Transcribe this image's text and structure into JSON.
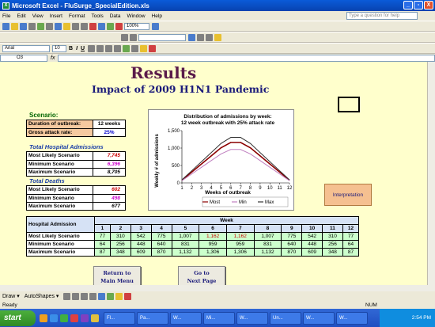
{
  "window": {
    "title": "Microsoft Excel - FluSurge_SpecialEdition.xls",
    "minimize": "_",
    "restore": "▫",
    "close": "X"
  },
  "menu": {
    "items": [
      "File",
      "Edit",
      "View",
      "Insert",
      "Format",
      "Tools",
      "Data",
      "Window",
      "Help"
    ],
    "help_placeholder": "Type a question for help"
  },
  "toolbar": {
    "zoom": "100%",
    "font_name": "Arial",
    "font_size": "10",
    "bold": "B",
    "italic": "I",
    "underline": "U"
  },
  "formula_bar": {
    "name_box": "O3",
    "fx": "fx",
    "content": ""
  },
  "sheet": {
    "title": "Results",
    "subtitle": "Impact of 2009 H1N1 Pandemic",
    "scenario_label": "Scenario:",
    "scenario": [
      {
        "key": "Duration of outbreak:",
        "value": "12 weeks"
      },
      {
        "key": "Gross attack rate:",
        "value": "25%"
      }
    ],
    "admissions_label": "Total Hospital Admissions",
    "admissions": [
      {
        "key": "Most Likely Scenario",
        "value": "7,745",
        "color": "#cc0000"
      },
      {
        "key": "Minimum Scenario",
        "value": "6,396",
        "color": "#cc00cc"
      },
      {
        "key": "Maximum Scenario",
        "value": "8,705",
        "color": "#000000"
      }
    ],
    "deaths_label": "Total Deaths",
    "deaths": [
      {
        "key": "Most Likely Scenario",
        "value": "602",
        "color": "#cc0000"
      },
      {
        "key": "Minimum Scenario",
        "value": "498",
        "color": "#cc00cc"
      },
      {
        "key": "Maximum Scenario",
        "value": "677",
        "color": "#000000"
      }
    ],
    "interpretation_button": "Interpretation",
    "table": {
      "corner_label": "Hospital Admission",
      "week_label": "Week",
      "weeks": [
        "1",
        "2",
        "3",
        "4",
        "5",
        "6",
        "7",
        "8",
        "9",
        "10",
        "11",
        "12"
      ],
      "rows": [
        {
          "label": "Most Likely Scenario",
          "values": [
            "77",
            "310",
            "542",
            "775",
            "1,007",
            "1,162",
            "1,162",
            "1,007",
            "775",
            "542",
            "310",
            "77"
          ],
          "red": [
            5,
            6
          ]
        },
        {
          "label": "Minimum Scenario",
          "values": [
            "64",
            "256",
            "448",
            "640",
            "831",
            "959",
            "959",
            "831",
            "640",
            "448",
            "256",
            "64"
          ],
          "red": []
        },
        {
          "label": "Maximum Scenario",
          "values": [
            "87",
            "348",
            "609",
            "870",
            "1,132",
            "1,306",
            "1,306",
            "1,132",
            "870",
            "609",
            "348",
            "87"
          ],
          "red": []
        }
      ]
    },
    "return_button": [
      "Return to",
      "Main Menu"
    ],
    "next_button": [
      "Go to",
      "Next Page"
    ]
  },
  "chart_data": {
    "type": "line",
    "title": "Distribution of admissions by week:",
    "subtitle": "12 week outbreak with 25% attack rate",
    "xlabel": "Weeks of outbreak",
    "ylabel": "Weekly # of admissions",
    "x": [
      1,
      2,
      3,
      4,
      5,
      6,
      7,
      8,
      9,
      10,
      11,
      12
    ],
    "ylim": [
      0,
      1500
    ],
    "yticks": [
      "0",
      "500",
      "1,000",
      "1,500"
    ],
    "series": [
      {
        "name": "Most",
        "color": "#8b0000",
        "values": [
          77,
          310,
          542,
          775,
          1007,
          1162,
          1162,
          1007,
          775,
          542,
          310,
          77
        ]
      },
      {
        "name": "Min",
        "color": "#c080c0",
        "values": [
          64,
          256,
          448,
          640,
          831,
          959,
          959,
          831,
          640,
          448,
          256,
          64
        ]
      },
      {
        "name": "Max",
        "color": "#333333",
        "values": [
          87,
          348,
          609,
          870,
          1132,
          1306,
          1306,
          1132,
          870,
          609,
          348,
          87
        ]
      }
    ],
    "legend": "bottom"
  },
  "drawbar": {
    "draw": "Draw ▾",
    "autoshapes": "AutoShapes ▾"
  },
  "status": {
    "left": "Ready",
    "num": "NUM"
  },
  "taskbar": {
    "start": "start",
    "tasks": [
      "Fl...",
      "Pa...",
      "W...",
      "Mi...",
      "W...",
      "Un...",
      "W...",
      "W..."
    ],
    "clock": "2:54 PM"
  }
}
